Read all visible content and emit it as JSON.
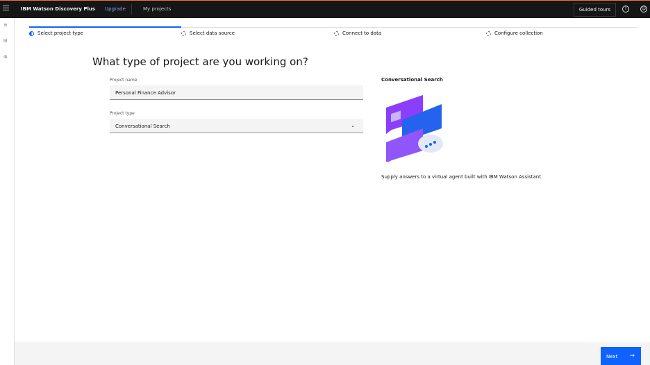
{
  "header": {
    "brand": "IBM Watson Discovery Plus",
    "upgrade": "Upgrade",
    "my_projects": "My projects",
    "guided_tours": "Guided tours",
    "help_icon": "?",
    "user_icon": "☺"
  },
  "rail": {
    "icons": [
      "≡",
      "⊟",
      "⊚"
    ]
  },
  "steps": [
    {
      "label": "Select project type",
      "state": "current"
    },
    {
      "label": "Select data source",
      "state": "incomplete"
    },
    {
      "label": "Connect to data",
      "state": "incomplete"
    },
    {
      "label": "Configure collection",
      "state": "incomplete"
    }
  ],
  "progress": 0.25,
  "title": "What type of project are you working on?",
  "form": {
    "name_label": "Project name",
    "name_value": "Personal Finance Advisor",
    "type_label": "Project type",
    "type_value": "Conversational Search"
  },
  "panel": {
    "heading": "Conversational Search",
    "description": "Supply answers to a virtual agent built with IBM Watson Assistant."
  },
  "footer": {
    "next": "Next",
    "next_icon": "→"
  },
  "colors": {
    "primary": "#0f62fe",
    "header": "#161616",
    "accent_top": "#e4733f"
  }
}
